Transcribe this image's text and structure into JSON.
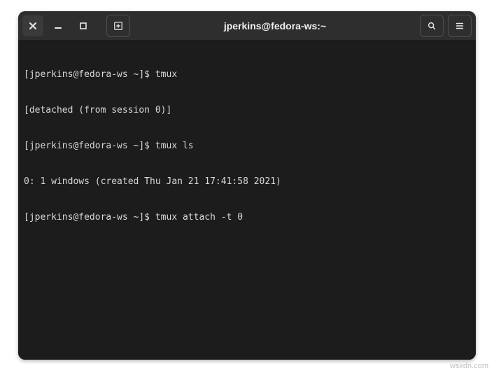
{
  "titlebar": {
    "title": "jperkins@fedora-ws:~"
  },
  "terminal": {
    "lines": [
      {
        "prompt": "[jperkins@fedora-ws ~]$ ",
        "cmd": "tmux"
      },
      {
        "text": "[detached (from session 0)]"
      },
      {
        "prompt": "[jperkins@fedora-ws ~]$ ",
        "cmd": "tmux ls"
      },
      {
        "text": "0: 1 windows (created Thu Jan 21 17:41:58 2021)"
      },
      {
        "prompt": "[jperkins@fedora-ws ~]$ ",
        "cmd": "tmux attach -t 0"
      }
    ]
  },
  "watermark": "wsxdn.com"
}
